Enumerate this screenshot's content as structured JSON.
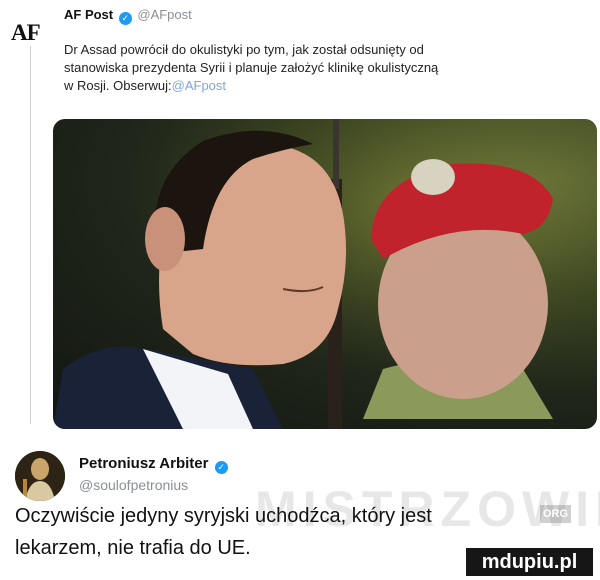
{
  "post1": {
    "logo_text": "AF",
    "author_name": "AF Post",
    "author_handle": "@AFpost",
    "body_lines": [
      "Dr Assad powrócił do okulistyki po tym, jak został odsunięty od",
      "stanowiska prezydenta Syrii i planuje założyć klinikę okulistyczną"
    ],
    "body_line3_prefix": "w Rosji. Obserwuj:",
    "body_line3_mention": "@AFpost",
    "verified_icon": "verified-badge-icon",
    "image_alt_subjects": [
      "man-in-suit",
      "guard-in-red-beret"
    ]
  },
  "post2": {
    "author_name": "Petroniusz Arbiter",
    "author_handle": "@soulofpetronius",
    "body_lines": [
      "Oczywiście jedyny syryjski uchodźca, który jest",
      "lekarzem, nie trafia do UE."
    ],
    "verified_icon": "verified-badge-icon"
  },
  "watermarks": {
    "main": "MISTRZOWIE",
    "tag": "ORG",
    "site_logo": "mdupiu.pl"
  },
  "colors": {
    "verified": "#1d9bf0",
    "handle": "#8a8f96",
    "mention": "#7fa5d8",
    "beret": "#c0232b"
  }
}
